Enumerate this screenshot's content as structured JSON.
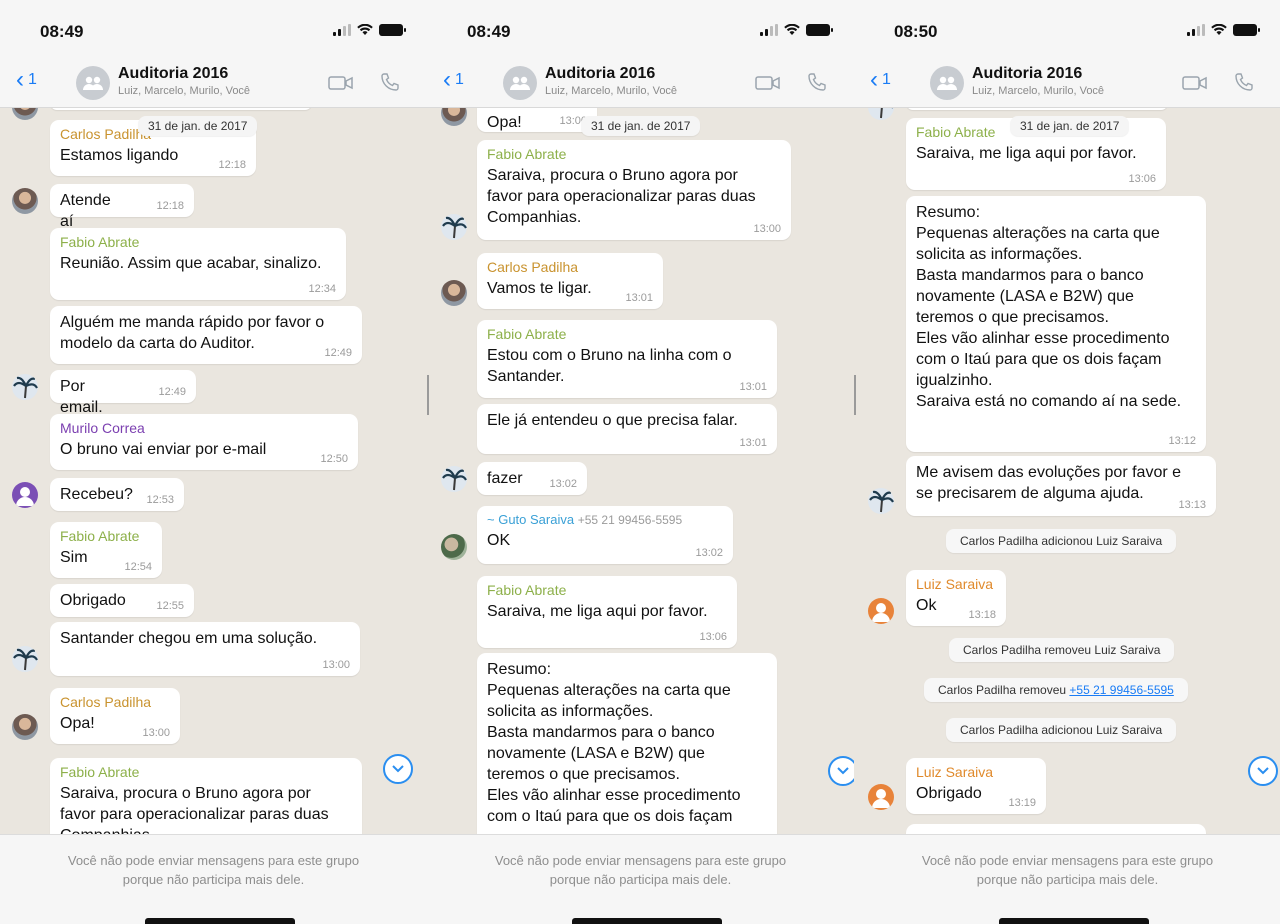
{
  "group": {
    "title": "Auditoria 2016",
    "subtitle": "Luiz, Marcelo, Murilo, Você",
    "back_count": "1"
  },
  "date_label": "31 de jan. de 2017",
  "footer_text": "Você não pode enviar mensagens para este grupo porque não participa mais dele.",
  "screens": [
    {
      "time": "08:49",
      "messages": [
        {
          "sender": "Carlos Padilha",
          "text": "Estamos ligando",
          "time": "12:18"
        },
        {
          "sender": "",
          "text": "Atende aí",
          "time": "12:18"
        },
        {
          "sender": "Fabio Abrate",
          "text": "Reunião. Assim que acabar, sinalizo.",
          "time": "12:34"
        },
        {
          "sender": "",
          "text": "Alguém me manda rápido por favor o\nmodelo da carta do Auditor.",
          "time": "12:49"
        },
        {
          "sender": "",
          "text": "Por email.",
          "time": "12:49"
        },
        {
          "sender": "Murilo Correa",
          "text": "O bruno vai enviar por e-mail",
          "time": "12:50"
        },
        {
          "sender": "",
          "text": "Recebeu?",
          "time": "12:53"
        },
        {
          "sender": "Fabio Abrate",
          "text": "Sim",
          "time": "12:54"
        },
        {
          "sender": "",
          "text": "Obrigado",
          "time": "12:55"
        },
        {
          "sender": "",
          "text": "Santander chegou em uma solução.",
          "time": "13:00"
        },
        {
          "sender": "Carlos Padilha",
          "text": "Opa!",
          "time": "13:00"
        },
        {
          "sender": "Fabio Abrate",
          "text": "Saraiva, procura o Bruno agora por\nfavor para operacionalizar paras duas\nCompanhias.",
          "time": ""
        }
      ]
    },
    {
      "time": "08:49",
      "messages": [
        {
          "sender": "",
          "text": "Opa!",
          "time": "13:00"
        },
        {
          "sender": "Fabio Abrate",
          "text": "Saraiva, procura o Bruno agora por\nfavor para operacionalizar paras duas\nCompanhias.",
          "time": "13:00"
        },
        {
          "sender": "Carlos Padilha",
          "text": "Vamos te ligar.",
          "time": "13:01"
        },
        {
          "sender": "Fabio Abrate",
          "text": "Estou com o Bruno na linha com o\nSantander.",
          "time": "13:01"
        },
        {
          "sender": "",
          "text": "Ele já entendeu o que precisa falar.",
          "time": "13:01"
        },
        {
          "sender": "",
          "text": "fazer",
          "time": "13:02"
        },
        {
          "sender": "~ Guto Saraiva",
          "sender_extra": "+55 21 99456-5595",
          "text": "OK",
          "time": "13:02"
        },
        {
          "sender": "Fabio Abrate",
          "text": "Saraiva, me liga aqui por favor.",
          "time": "13:06"
        },
        {
          "sender": "",
          "text": "Resumo:\nPequenas alterações na carta que\nsolicita as informações.\nBasta mandarmos para o banco\nnovamente (LASA e B2W) que\nteremos o que precisamos.\nEles vão alinhar esse procedimento\ncom o Itaú para que os dois façam",
          "time": ""
        }
      ]
    },
    {
      "time": "08:50",
      "messages": [
        {
          "sender": "Fabio Abrate",
          "text": "Saraiva, me liga aqui por favor.",
          "time": "13:06"
        },
        {
          "sender": "",
          "text": "Resumo:\nPequenas alterações na carta que\nsolicita as informações.\nBasta mandarmos para o banco\nnovamente (LASA e B2W) que\nteremos o que precisamos.\nEles vão alinhar esse procedimento\ncom o Itaú para que os dois façam\nigualzinho.\nSaraiva está no comando aí na sede.",
          "time": "13:12"
        },
        {
          "sender": "",
          "text": "Me avisem das evoluções por favor e\nse precisarem de alguma ajuda.",
          "time": "13:13"
        },
        {
          "sender": "Luiz Saraiva",
          "text": "Ok",
          "time": "13:18"
        },
        {
          "sender": "Luiz Saraiva",
          "text": "Obrigado",
          "time": "13:19"
        }
      ],
      "system": [
        "Carlos Padilha adicionou Luiz Saraiva",
        "Carlos Padilha removeu Luiz Saraiva",
        "Carlos Padilha removeu",
        "Carlos Padilha adicionou Luiz Saraiva"
      ],
      "system_link": "+55 21 99456-5595"
    }
  ]
}
